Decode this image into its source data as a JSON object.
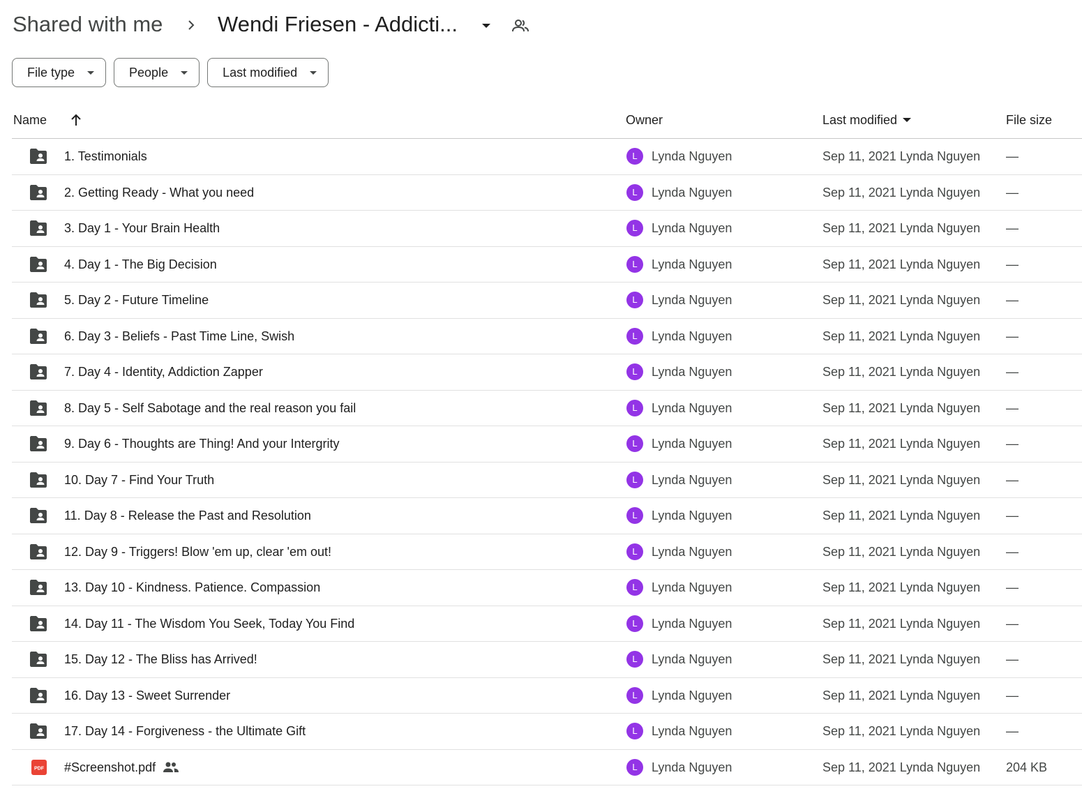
{
  "breadcrumb": {
    "root": "Shared with me",
    "current": "Wendi Friesen - Addicti..."
  },
  "filters": [
    {
      "label": "File type"
    },
    {
      "label": "People"
    },
    {
      "label": "Last modified"
    }
  ],
  "table": {
    "headers": {
      "name": "Name",
      "owner": "Owner",
      "last_modified": "Last modified",
      "file_size": "File size"
    },
    "rows": [
      {
        "type": "folder",
        "name": "1. Testimonials",
        "owner_initial": "L",
        "owner": "Lynda Nguyen",
        "modified": "Sep 11, 2021 Lynda Nguyen",
        "size": "—"
      },
      {
        "type": "folder",
        "name": "2. Getting Ready - What you need",
        "owner_initial": "L",
        "owner": "Lynda Nguyen",
        "modified": "Sep 11, 2021 Lynda Nguyen",
        "size": "—"
      },
      {
        "type": "folder",
        "name": "3. Day 1 - Your Brain Health",
        "owner_initial": "L",
        "owner": "Lynda Nguyen",
        "modified": "Sep 11, 2021 Lynda Nguyen",
        "size": "—"
      },
      {
        "type": "folder",
        "name": "4. Day 1 - The Big Decision",
        "owner_initial": "L",
        "owner": "Lynda Nguyen",
        "modified": "Sep 11, 2021 Lynda Nguyen",
        "size": "—"
      },
      {
        "type": "folder",
        "name": "5. Day 2 - Future Timeline",
        "owner_initial": "L",
        "owner": "Lynda Nguyen",
        "modified": "Sep 11, 2021 Lynda Nguyen",
        "size": "—"
      },
      {
        "type": "folder",
        "name": "6. Day 3 - Beliefs - Past Time Line, Swish",
        "owner_initial": "L",
        "owner": "Lynda Nguyen",
        "modified": "Sep 11, 2021 Lynda Nguyen",
        "size": "—"
      },
      {
        "type": "folder",
        "name": "7. Day 4 - Identity, Addiction Zapper",
        "owner_initial": "L",
        "owner": "Lynda Nguyen",
        "modified": "Sep 11, 2021 Lynda Nguyen",
        "size": "—"
      },
      {
        "type": "folder",
        "name": "8. Day 5 - Self Sabotage and the real reason you fail",
        "owner_initial": "L",
        "owner": "Lynda Nguyen",
        "modified": "Sep 11, 2021 Lynda Nguyen",
        "size": "—"
      },
      {
        "type": "folder",
        "name": "9. Day 6 - Thoughts are Thing! And your Intergrity",
        "owner_initial": "L",
        "owner": "Lynda Nguyen",
        "modified": "Sep 11, 2021 Lynda Nguyen",
        "size": "—"
      },
      {
        "type": "folder",
        "name": "10. Day 7 - Find Your Truth",
        "owner_initial": "L",
        "owner": "Lynda Nguyen",
        "modified": "Sep 11, 2021 Lynda Nguyen",
        "size": "—"
      },
      {
        "type": "folder",
        "name": "11. Day 8 - Release the Past and Resolution",
        "owner_initial": "L",
        "owner": "Lynda Nguyen",
        "modified": "Sep 11, 2021 Lynda Nguyen",
        "size": "—"
      },
      {
        "type": "folder",
        "name": "12. Day 9 - Triggers! Blow 'em up, clear 'em out!",
        "owner_initial": "L",
        "owner": "Lynda Nguyen",
        "modified": "Sep 11, 2021 Lynda Nguyen",
        "size": "—"
      },
      {
        "type": "folder",
        "name": "13. Day 10 - Kindness. Patience. Compassion",
        "owner_initial": "L",
        "owner": "Lynda Nguyen",
        "modified": "Sep 11, 2021 Lynda Nguyen",
        "size": "—"
      },
      {
        "type": "folder",
        "name": "14. Day 11 - The Wisdom You Seek, Today You Find",
        "owner_initial": "L",
        "owner": "Lynda Nguyen",
        "modified": "Sep 11, 2021 Lynda Nguyen",
        "size": "—"
      },
      {
        "type": "folder",
        "name": "15. Day 12 - The Bliss has Arrived!",
        "owner_initial": "L",
        "owner": "Lynda Nguyen",
        "modified": "Sep 11, 2021 Lynda Nguyen",
        "size": "—"
      },
      {
        "type": "folder",
        "name": "16. Day 13 - Sweet Surrender",
        "owner_initial": "L",
        "owner": "Lynda Nguyen",
        "modified": "Sep 11, 2021 Lynda Nguyen",
        "size": "—"
      },
      {
        "type": "folder",
        "name": "17. Day 14 - Forgiveness - the Ultimate Gift",
        "owner_initial": "L",
        "owner": "Lynda Nguyen",
        "modified": "Sep 11, 2021 Lynda Nguyen",
        "size": "—"
      },
      {
        "type": "pdf",
        "icon_label": "PDF",
        "name": "#Screenshot.pdf",
        "shared": true,
        "owner_initial": "L",
        "owner": "Lynda Nguyen",
        "modified": "Sep 11, 2021 Lynda Nguyen",
        "size": "204 KB"
      }
    ]
  },
  "colors": {
    "avatar": "#9334e6",
    "pdf": "#ea4335",
    "folder": "#444746"
  }
}
